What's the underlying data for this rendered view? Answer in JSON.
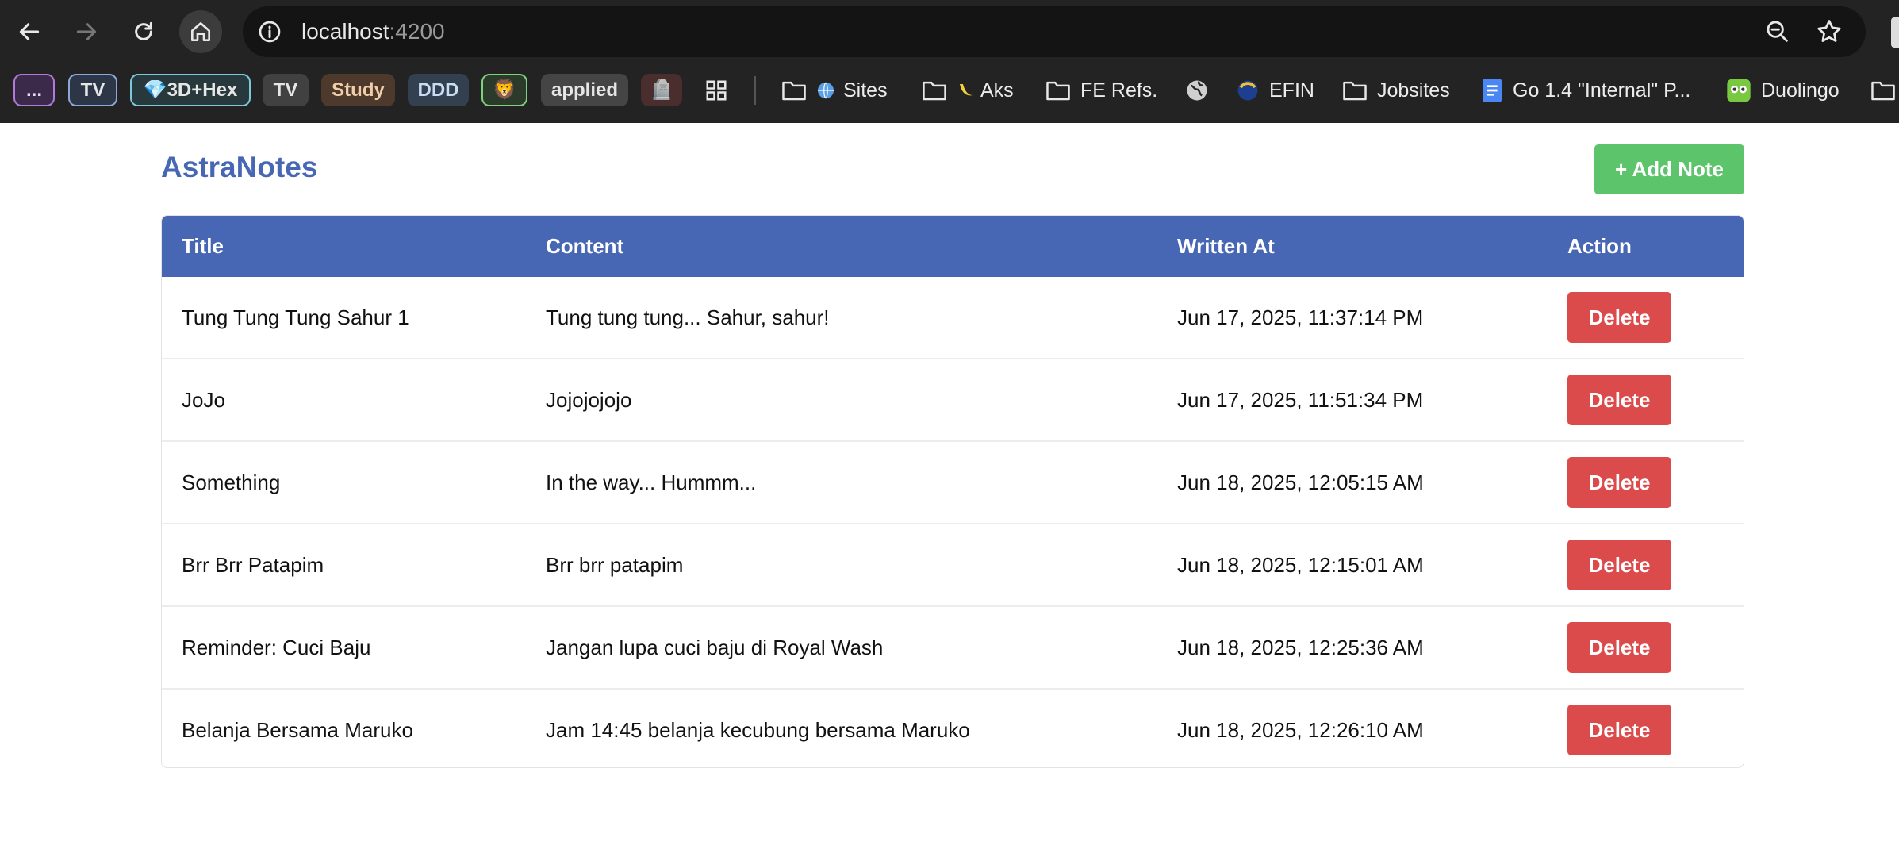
{
  "browser": {
    "url_host": "localhost",
    "url_port": ":4200",
    "icons": [
      "back-icon",
      "forward-icon",
      "reload-icon",
      "home-icon",
      "site-info-icon",
      "zoom-icon",
      "star-icon"
    ],
    "bookmarks": {
      "group_more": "...",
      "group_tv": "TV",
      "group_3dhex": "💎3D+Hex",
      "group_tv2": "TV",
      "group_study": "Study",
      "group_ddd": "DDD",
      "group_emoji": "🦁",
      "group_applied": "applied",
      "group_emoji2": "🪦",
      "sites": "Sites",
      "aks": "Aks",
      "fe_refs": "FE Refs.",
      "efin": "EFIN",
      "jobsites": "Jobsites",
      "go14": "Go 1.4 \"Internal\" P...",
      "duolingo": "Duolingo"
    }
  },
  "app": {
    "title": "AstraNotes",
    "add_label": "+ Add Note",
    "columns": [
      "Title",
      "Content",
      "Written At",
      "Action"
    ],
    "delete_label": "Delete",
    "notes": [
      {
        "title": "Tung Tung Tung Sahur 1",
        "content": "Tung tung tung... Sahur, sahur!",
        "written_at": "Jun 17, 2025, 11:37:14 PM"
      },
      {
        "title": "JoJo",
        "content": "Jojojojojo",
        "written_at": "Jun 17, 2025, 11:51:34 PM"
      },
      {
        "title": "Something",
        "content": "In the way... Hummm...",
        "written_at": "Jun 18, 2025, 12:05:15 AM"
      },
      {
        "title": "Brr Brr Patapim",
        "content": "Brr brr patapim",
        "written_at": "Jun 18, 2025, 12:15:01 AM"
      },
      {
        "title": "Reminder: Cuci Baju",
        "content": "Jangan lupa cuci baju di Royal Wash",
        "written_at": "Jun 18, 2025, 12:25:36 AM"
      },
      {
        "title": "Belanja Bersama Maruko",
        "content": "Jam 14:45 belanja kecubung bersama Maruko",
        "written_at": "Jun 18, 2025, 12:26:10 AM"
      }
    ]
  },
  "colors": {
    "accent": "#4767b4",
    "add_button": "#5cc46a",
    "delete_button": "#dc4b4b"
  }
}
